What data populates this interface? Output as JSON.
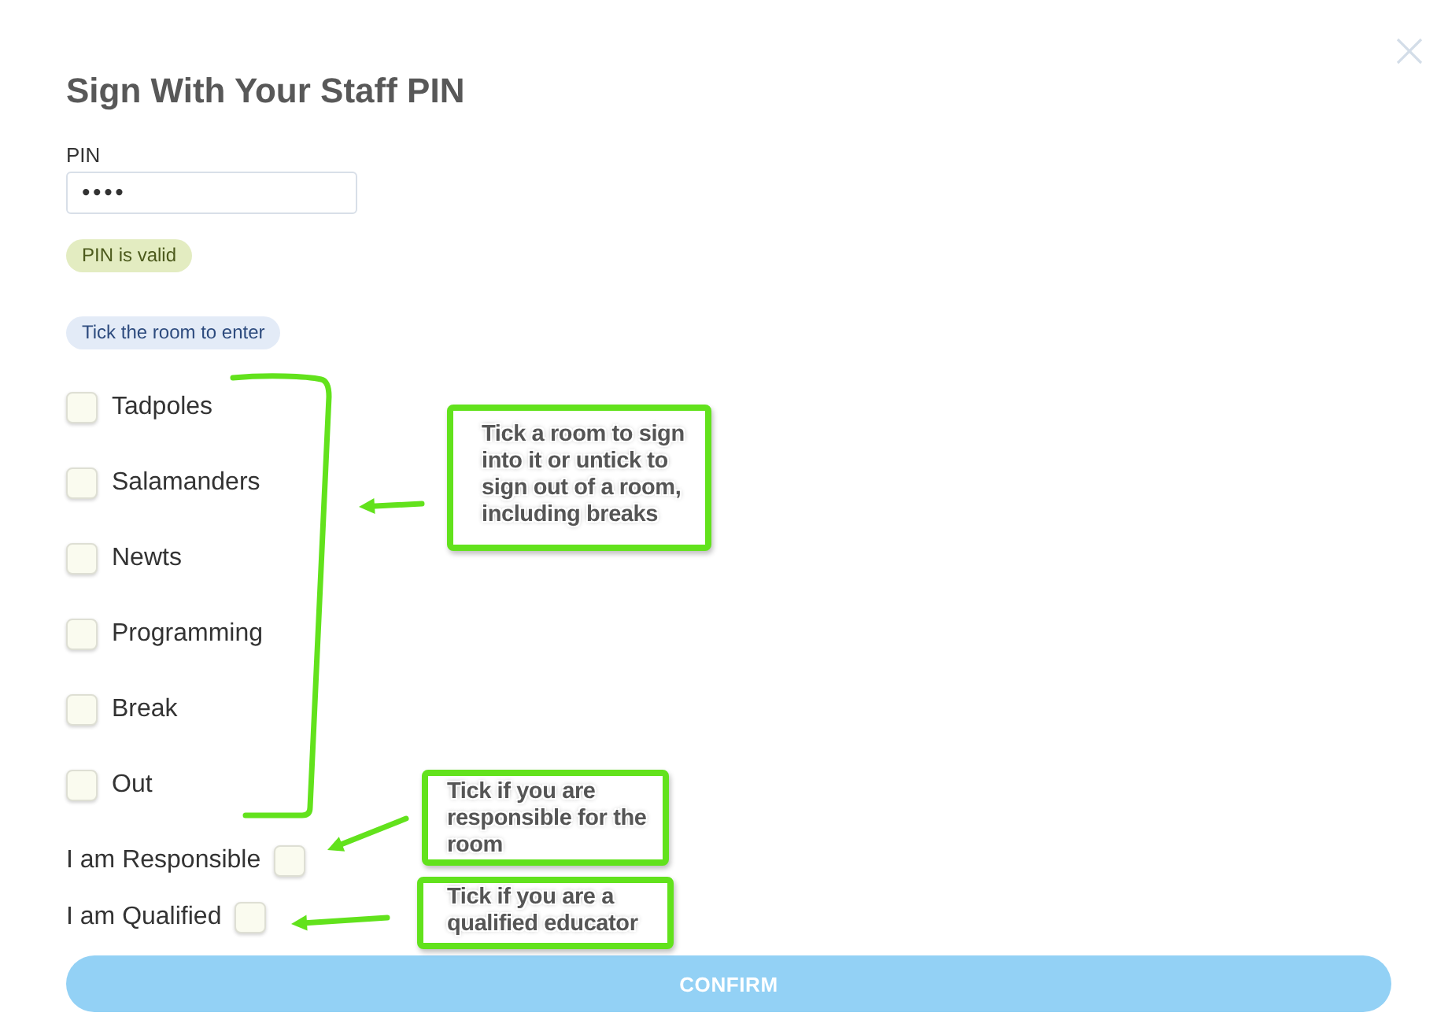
{
  "dialog": {
    "title": "Sign With Your Staff PIN"
  },
  "pin_field": {
    "label": "PIN",
    "value": "••••"
  },
  "pin_status": "PIN is valid",
  "room_hint": "Tick the room to enter",
  "rooms": [
    {
      "label": "Tadpoles",
      "checked": false
    },
    {
      "label": "Salamanders",
      "checked": false
    },
    {
      "label": "Newts",
      "checked": false
    },
    {
      "label": "Programming",
      "checked": false
    },
    {
      "label": "Break",
      "checked": false
    },
    {
      "label": "Out",
      "checked": false
    }
  ],
  "declarations": [
    {
      "label": "I am Responsible",
      "checked": false
    },
    {
      "label": "I am Qualified",
      "checked": false
    }
  ],
  "confirm_button": {
    "label": "CONFIRM"
  },
  "annotations": [
    {
      "text": "Tick a room to sign into it or untick to sign out of a room, including breaks"
    },
    {
      "text": "Tick if you are responsible for the room"
    },
    {
      "text": "Tick if you are a qualified educator"
    }
  ]
}
